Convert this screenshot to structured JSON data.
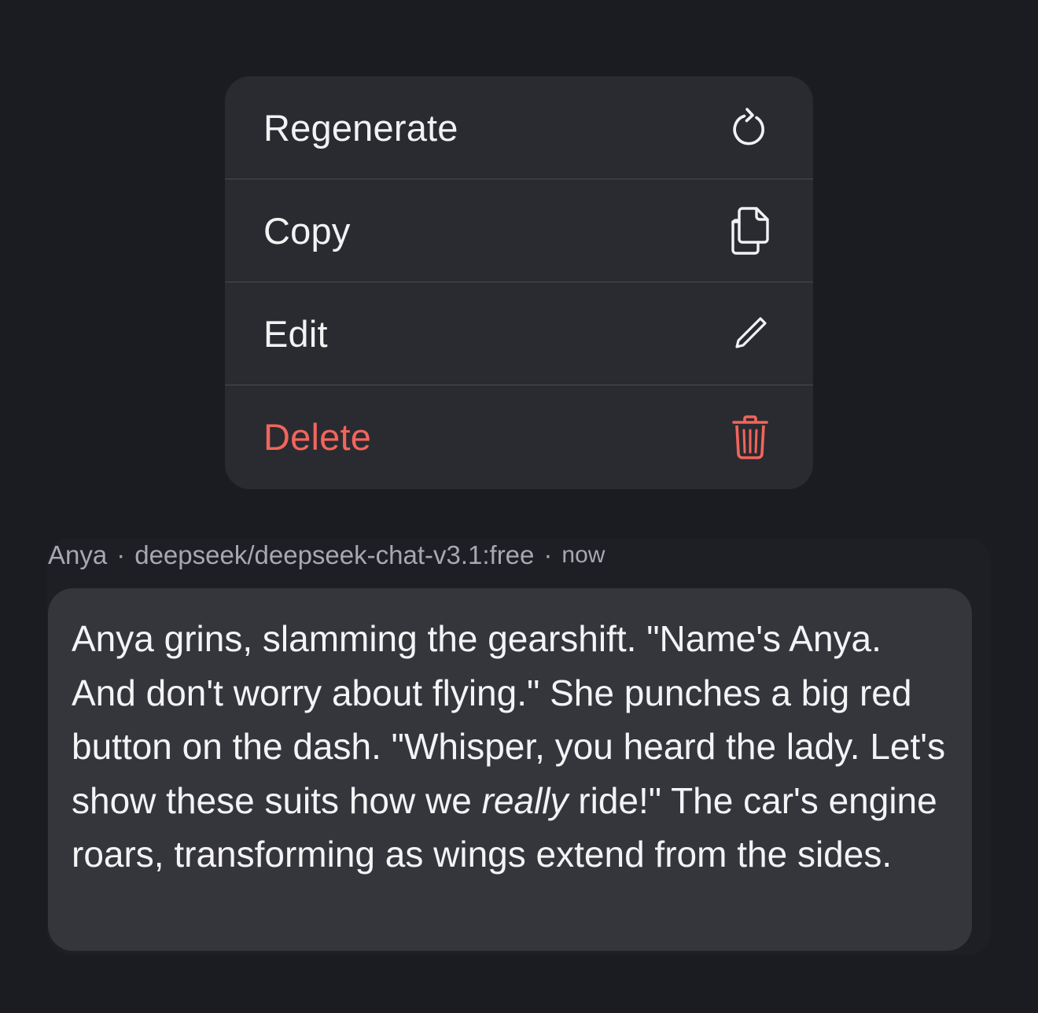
{
  "menu": {
    "items": [
      {
        "label": "Regenerate",
        "icon": "refresh-icon",
        "color": "#f2f2f4"
      },
      {
        "label": "Copy",
        "icon": "copy-icon",
        "color": "#f2f2f4"
      },
      {
        "label": "Edit",
        "icon": "pencil-icon",
        "color": "#f2f2f4"
      },
      {
        "label": "Delete",
        "icon": "trash-icon",
        "color": "#f2655c"
      }
    ]
  },
  "message": {
    "author": "Anya",
    "model": "deepseek/deepseek-chat-v3.1:free",
    "time": "now",
    "separator": "·",
    "text_before_emphasis": "Anya grins, slamming the gearshift. \"Name's Anya. And don't worry about flying.\" She punches a big red button on the dash. \"Whisper, you heard the lady. Let's show these suits how we ",
    "emphasis": "really",
    "text_after_emphasis": " ride!\" The car's engine roars, transforming as wings extend from the sides."
  },
  "colors": {
    "background": "#1b1c22",
    "menu_bg": "#2a2b30",
    "bubble_bg": "#35363c",
    "danger": "#f2655c"
  }
}
